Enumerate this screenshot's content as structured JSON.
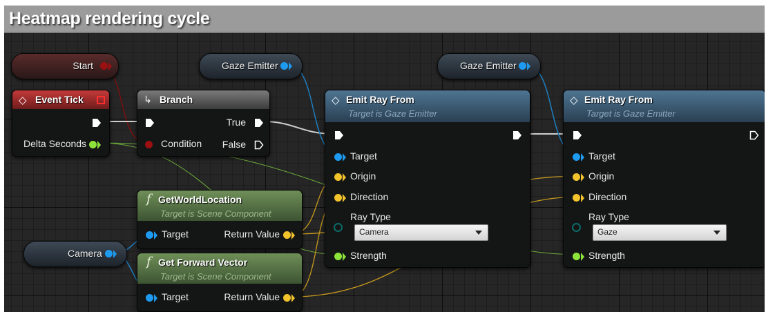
{
  "comment": {
    "title": "Heatmap rendering cycle"
  },
  "colors": {
    "exec": "#ffffff",
    "object": "#1e9bf0",
    "vector": "#f2c32b",
    "float": "#8ee33a",
    "bool": "#9b1010",
    "enum": "#0b6b68"
  },
  "variables": {
    "start": "Start",
    "gaze_emitter_1": "Gaze Emitter",
    "gaze_emitter_2": "Gaze Emitter",
    "camera": "Camera"
  },
  "event_tick": {
    "title": "Event Tick",
    "delta_seconds": "Delta Seconds"
  },
  "branch": {
    "title": "Branch",
    "true_label": "True",
    "false_label": "False",
    "condition": "Condition"
  },
  "get_world_location": {
    "title": "GetWorldLocation",
    "subtitle": "Target is Scene Component",
    "target": "Target",
    "return_value": "Return Value"
  },
  "get_forward_vector": {
    "title": "Get Forward Vector",
    "subtitle": "Target is Scene Component",
    "target": "Target",
    "return_value": "Return Value"
  },
  "emit_ray_1": {
    "title": "Emit Ray From",
    "subtitle": "Target is Gaze Emitter",
    "target": "Target",
    "origin": "Origin",
    "direction": "Direction",
    "ray_type": "Ray Type",
    "ray_type_value": "Camera",
    "strength": "Strength"
  },
  "emit_ray_2": {
    "title": "Emit Ray From",
    "subtitle": "Target is Gaze Emitter",
    "target": "Target",
    "origin": "Origin",
    "direction": "Direction",
    "ray_type": "Ray Type",
    "ray_type_value": "Gaze",
    "strength": "Strength"
  }
}
